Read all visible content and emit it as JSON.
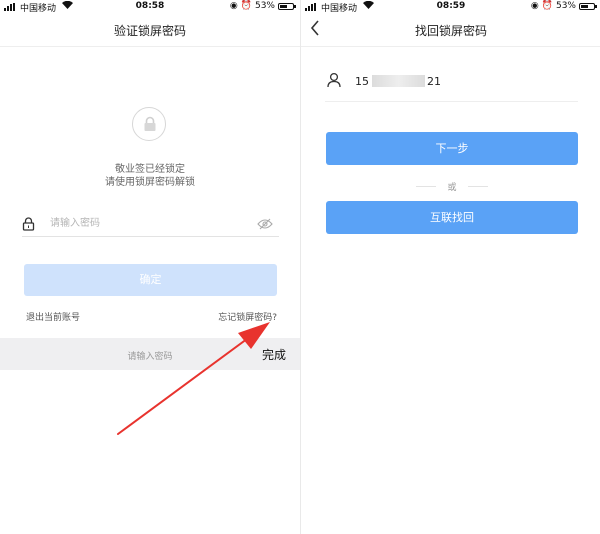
{
  "left_screen": {
    "status_bar": {
      "carrier": "中国移动",
      "time": "08:58",
      "battery": "53%"
    },
    "nav_title": "验证锁屏密码",
    "locked_line1": "敬业签已经锁定",
    "locked_line2": "请使用锁屏密码解锁",
    "password_placeholder": "请输入密码",
    "confirm_label": "确定",
    "logout_label": "退出当前账号",
    "forgot_label": "忘记锁屏密码?",
    "keyboard_bar": {
      "placeholder": "请输入密码",
      "done_label": "完成"
    },
    "annotation_color": "#e8332e"
  },
  "right_screen": {
    "status_bar": {
      "carrier": "中国移动",
      "time": "08:59",
      "battery": "53%"
    },
    "nav_title": "找回锁屏密码",
    "phone_prefix": "15",
    "phone_suffix": "21",
    "next_label": "下一步",
    "or_label": "或",
    "recover_label": "互联找回",
    "accent_color": "#5aa2f6"
  }
}
